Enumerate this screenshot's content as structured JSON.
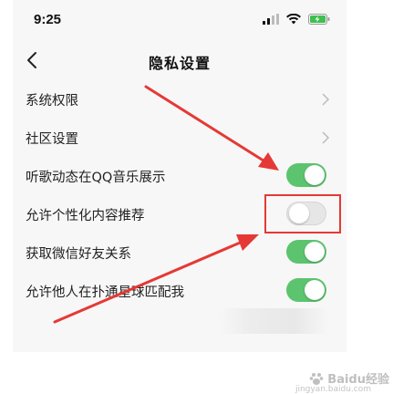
{
  "status_bar": {
    "time": "9:25",
    "icons": [
      "signal-icon",
      "wifi-icon",
      "battery-charging-icon"
    ]
  },
  "header": {
    "back_icon": "chevron-left-icon",
    "title": "隐私设置"
  },
  "settings": [
    {
      "label": "系统权限",
      "control": "chevron"
    },
    {
      "label": "社区设置",
      "control": "chevron"
    },
    {
      "label": "听歌动态在QQ音乐展示",
      "control": "toggle",
      "on": true
    },
    {
      "label": "允许个性化内容推荐",
      "control": "toggle",
      "on": false
    },
    {
      "label": "获取微信好友关系",
      "control": "toggle",
      "on": true
    },
    {
      "label": "允许他人在扑通星球匹配我",
      "control": "toggle",
      "on": true
    }
  ],
  "colors": {
    "toggle_on": "#5cc46e",
    "toggle_off": "#e6e6e6",
    "annotation_red": "#e53935",
    "battery_green": "#3fbf4f"
  },
  "watermark": {
    "text": "Baidu经验",
    "sub": "jingyan.baidu.com"
  }
}
